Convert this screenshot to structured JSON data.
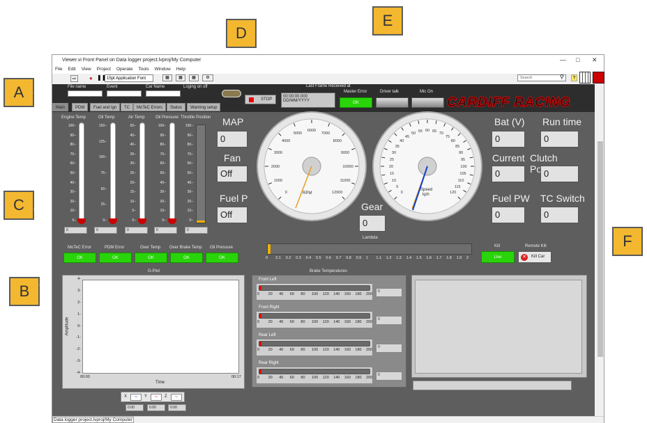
{
  "window": {
    "title": "Viewer.vi Front Panel on Data logger project.lvproj/My Computer",
    "status": "Data logger project.lvproj/My Computer"
  },
  "menu": [
    "File",
    "Edit",
    "View",
    "Project",
    "Operate",
    "Tools",
    "Window",
    "Help"
  ],
  "toolbar": {
    "font": "15pt Application Font",
    "search_placeholder": "Search"
  },
  "callouts": [
    "A",
    "B",
    "C",
    "D",
    "E",
    "F"
  ],
  "header": {
    "file_name": "File name",
    "event": "Event",
    "car_name": "Car Name",
    "logging": "Loging on off",
    "stop": "STOP",
    "last_frame_label": "Last Frame Received at",
    "last_frame_time": "00:00:00.000",
    "last_frame_date": "DD/MM/YYYY",
    "master_error": "Master Error",
    "driver_talk": "Driver talk",
    "mic_on": "Mic On",
    "ok": "OK",
    "logo": "CARDIFF RACING"
  },
  "tabs": [
    "Main",
    "PDM",
    "Fuel and Ign",
    "TC",
    "MoTeC Errors",
    "Status",
    "Warning setup"
  ],
  "temps": {
    "engine": "Engine Temp",
    "oil": "Oil Temp",
    "air": "Air Temp",
    "oil_pressure": "Oil Pressure",
    "throttle": "Throttle Position",
    "val": "0"
  },
  "scales": {
    "engine": [
      "100",
      "90",
      "80",
      "70",
      "60",
      "50",
      "40",
      "30",
      "20",
      "10",
      "0"
    ],
    "oil": [
      "150",
      "125",
      "100",
      "75",
      "50",
      "25",
      "0"
    ],
    "air": [
      "50",
      "45",
      "40",
      "35",
      "30",
      "25",
      "20",
      "15",
      "10",
      "5",
      "0"
    ],
    "oil_pressure": [
      "100",
      "90",
      "80",
      "70",
      "60",
      "50",
      "40",
      "30",
      "20",
      "10",
      "0"
    ],
    "throttle": [
      "100",
      "90",
      "80",
      "70",
      "60",
      "50",
      "40",
      "30",
      "20",
      "10",
      "0"
    ]
  },
  "errors": {
    "motec": "MoTeC Error",
    "pdm": "PDM Error",
    "over_temp": "Over Temp",
    "over_brake": "Over Brake Temp",
    "oil_pressure": "Oil Pressure",
    "ok": "OK"
  },
  "indicators": {
    "map": "MAP",
    "map_val": "0",
    "fan": "Fan",
    "fan_val": "Off",
    "fuel_p": "Fuel P",
    "fuel_p_val": "Off",
    "gear": "Gear",
    "gear_val": "0",
    "bat": "Bat (V)",
    "bat_val": "0",
    "run_time": "Run time",
    "run_time_val": "0",
    "current": "Current",
    "current_val": "0",
    "clutch": "Clutch Position",
    "clutch_val": "0",
    "fuel_pw": "Fuel PW",
    "fuel_pw_val": "0",
    "tc_switch": "TC Switch",
    "tc_switch_val": "0"
  },
  "rpm": {
    "label": "RPM",
    "ticks": [
      "0",
      "1000",
      "2000",
      "3000",
      "4000",
      "5000",
      "6000",
      "7000",
      "8000",
      "9000",
      "10000",
      "11000",
      "12000"
    ],
    "value": 0
  },
  "speed": {
    "label": "Speed",
    "unit": "kph",
    "ticks": [
      "0",
      "5",
      "10",
      "15",
      "20",
      "25",
      "30",
      "35",
      "40",
      "45",
      "50",
      "55",
      "60",
      "65",
      "70",
      "75",
      "80",
      "85",
      "90",
      "95",
      "100",
      "105",
      "110",
      "115",
      "120"
    ],
    "value": 0
  },
  "lambda": {
    "label": "Lambda",
    "ticks": [
      "0",
      "0.1",
      "0.2",
      "0.3",
      "0.4",
      "0.5",
      "0.6",
      "0.7",
      "0.8",
      "0.9",
      "1",
      "1.1",
      "1.2",
      "1.3",
      "1.4",
      "1.5",
      "1.6",
      "1.7",
      "1.8",
      "1.9",
      "2"
    ]
  },
  "kill": {
    "label": "Kill",
    "state": "Live",
    "remote_label": "Remote Kill",
    "button": "Kill Car"
  },
  "gplot": {
    "title": "G-Plot",
    "ylabel": "Amplitude",
    "xlabel": "Time",
    "yticks": [
      "4",
      "3",
      "2",
      "1",
      "0",
      "-1",
      "-2",
      "-3",
      "-4"
    ],
    "x_start": "00:00",
    "x_end": "00:17",
    "legend": [
      "X",
      "Y",
      "Z"
    ],
    "vals": [
      "0.00",
      "0.00",
      "0.00"
    ]
  },
  "brakes": {
    "title": "Brake Temperatures",
    "items": [
      "Front Left",
      "Front Right",
      "Rear Left",
      "Rear Right"
    ],
    "ticks": [
      "0",
      "20",
      "40",
      "60",
      "80",
      "100",
      "120",
      "140",
      "160",
      "180",
      "200"
    ],
    "val": "0"
  }
}
